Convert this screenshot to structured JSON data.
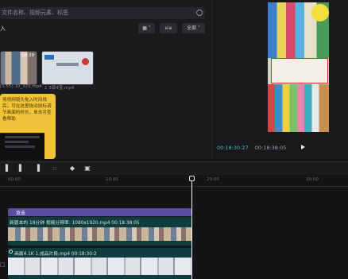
{
  "media": {
    "search_placeholder": "文件名称、视频元素、标签",
    "import_label": "入",
    "toolbar": {
      "sort_label": "▦ ˅",
      "filter_label": "⊎≡",
      "all_label": "全部 ˅"
    },
    "items": [
      {
        "duration": "18:39",
        "caption": "[3:55] 10_321.mp4"
      },
      {
        "duration": "",
        "caption": "1 3部4宝.mp4"
      }
    ],
    "tip_text": "将视频镜头拖入时间线后，可在这里拖动鼠标调节画面的时长，单击可查看帮助"
  },
  "player": {
    "current_time": "00:18:30:27",
    "total_time": "00:18:38:05"
  },
  "timeline": {
    "ruler_labels": [
      "00:00",
      "10:00",
      "20:00",
      "30:00"
    ],
    "text_track_label": "双击",
    "clip1_label": "新版本的 18分钟 视频分辨率: 1080x1920.mp4  00:18:38:05",
    "clip2_label": "画面4.1K  1.成品片段.mp4  00:18:30:2"
  },
  "colors": {
    "accent": "#4fb4cd",
    "clip": "#0f3c3f",
    "text_track": "#5a4aa0",
    "tip": "#f0c33a"
  }
}
